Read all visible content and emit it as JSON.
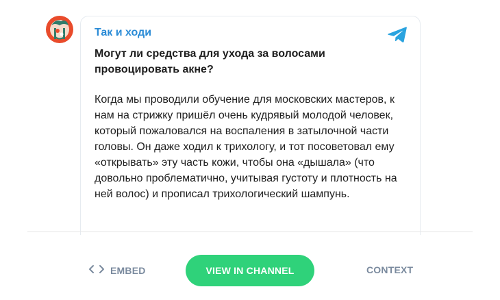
{
  "post": {
    "channel_name": "Так и ходи",
    "title": "Могут ли средства для ухода за волосами провоцировать акне?",
    "body": "Когда мы проводили обучение для московских мастеров, к нам на стрижку пришёл очень кудрявый молодой человек, который пожаловался на воспаления в затылочной части головы. Он даже ходил к трихологу, и тот посоветовал ему «открывать» эту часть кожи, чтобы она «дышала» (что довольно проблематично, учитывая густоту и плотность на ней волос) и прописал трихологический шампунь."
  },
  "footer": {
    "embed_icon": "< >",
    "embed_label": "EMBED",
    "view_label": "VIEW IN CHANNEL",
    "context_label": "CONTEXT"
  },
  "colors": {
    "channel_link": "#2a8bd6",
    "telegram_icon": "#2aa3df",
    "view_button": "#2fd27a",
    "footer_link": "#7a8a9e"
  },
  "icons": {
    "avatar": "channel-avatar-illustration",
    "telegram": "telegram-plane-icon",
    "embed": "code-brackets-icon"
  }
}
